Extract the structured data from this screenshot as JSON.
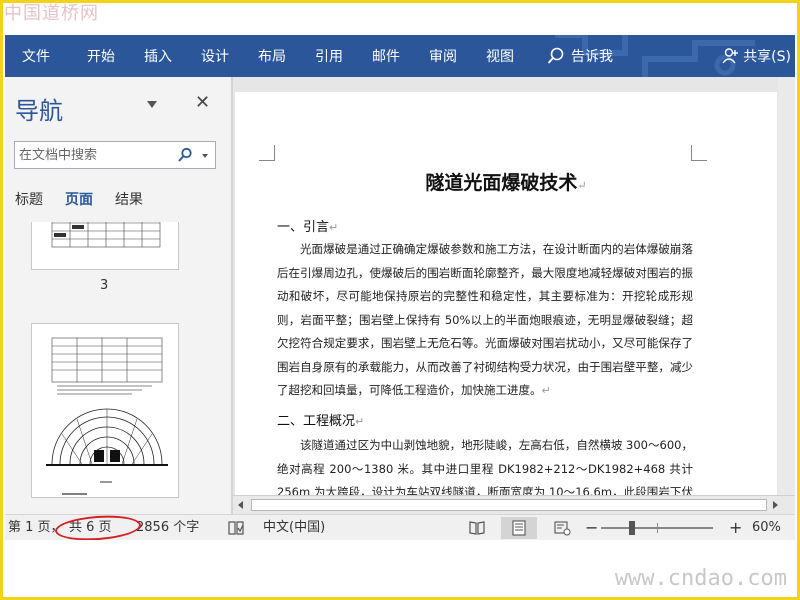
{
  "watermark_top": "中国道桥网",
  "watermark_bottom": "www.cndao.com",
  "ribbon": {
    "tabs": [
      "文件",
      "开始",
      "插入",
      "设计",
      "布局",
      "引用",
      "邮件",
      "审阅",
      "视图"
    ],
    "tell_me": "告诉我",
    "share": "共享(S)",
    "color": "#2b579a"
  },
  "nav": {
    "title": "导航",
    "close": "✕",
    "search_placeholder": "在文档中搜索",
    "tabs": [
      "标题",
      "页面",
      "结果"
    ],
    "active_tab": "页面",
    "thumb_page_number": "3"
  },
  "document": {
    "title": "隧道光面爆破技术",
    "para_mark": "↵",
    "sections": [
      {
        "heading": "一、引言",
        "paragraph": "光面爆破是通过正确确定爆破参数和施工方法，在设计断面内的岩体爆破崩落后在引爆周边孔，使爆破后的围岩断面轮廓整齐，最大限度地减轻爆破对围岩的振动和破坏，尽可能地保持原岩的完整性和稳定性，其主要标准为：开挖轮成形规则，岩面平整；围岩壁上保持有 50%以上的半面炮眼痕迹，无明显爆破裂缝；超欠挖符合规定要求，围岩壁上无危石等。光面爆破对围岩扰动小，又尽可能保存了围岩自身原有的承载能力，从而改善了衬砌结构受力状况，由于围岩壁平整，减少了超挖和回填量，可降低工程造价，加快施工进度。"
      },
      {
        "heading": "二、工程概况",
        "paragraph": "该隧道通过区为中山剥蚀地貌，地形陡峻，左高右低，自然横坡 300～600，绝对高程 200～1380 米。其中进口里程 DK1982+212～DK1982+468 共计 256m 为大跨段，设计为车站双线隧道，断面宽度为 10～16.6m，此段围岩下伏地层以奥陶"
      }
    ]
  },
  "status": {
    "page_info": "第 1 页，",
    "total_pages": "共 6 页",
    "word_count": "2856 个字",
    "language": "中文(中国)",
    "zoom_minus": "−",
    "zoom_plus": "+",
    "zoom": "60%",
    "zoom_level_percent": 60,
    "highlight_color": "#d42020"
  }
}
